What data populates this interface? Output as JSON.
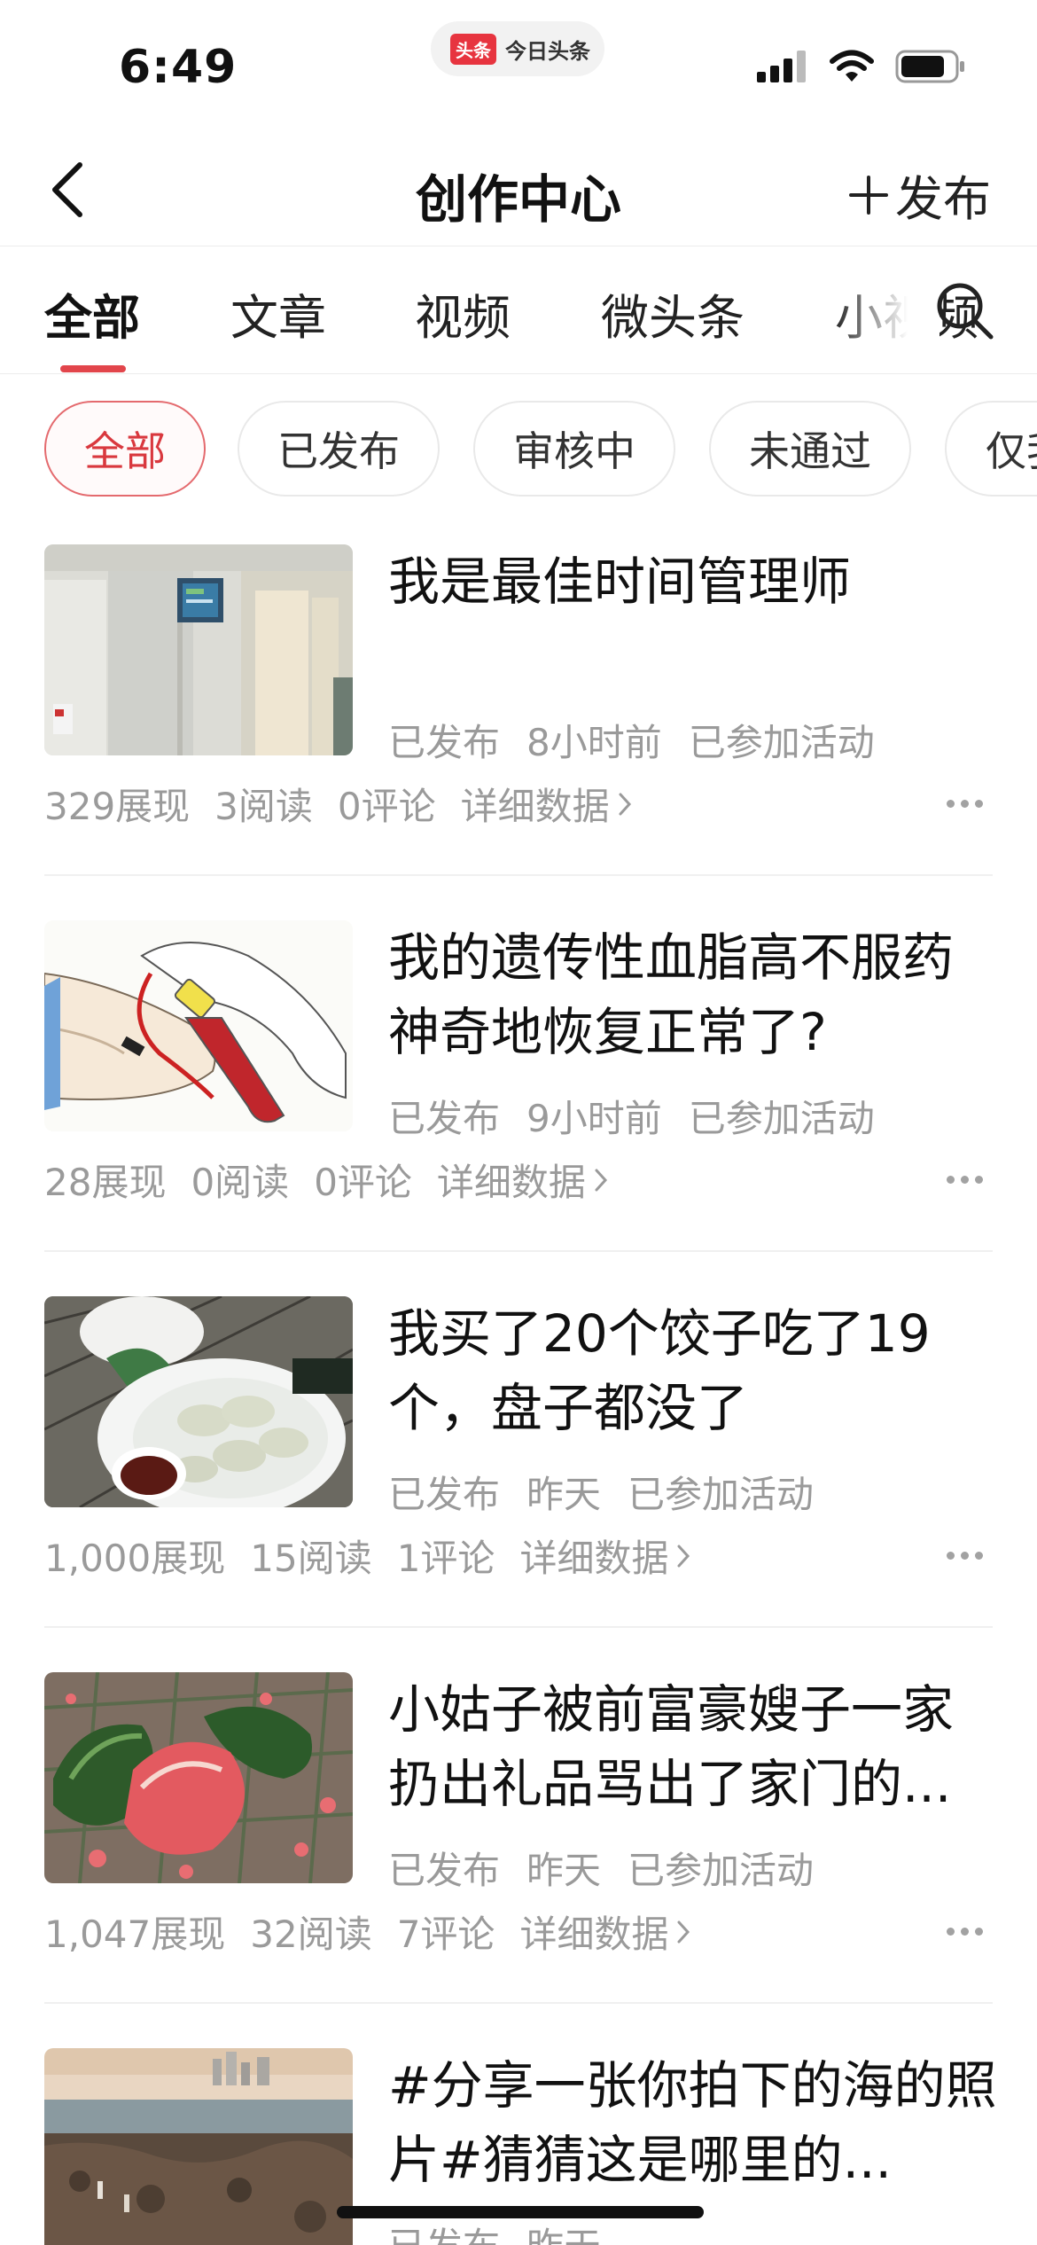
{
  "status_bar": {
    "time": "6:49",
    "pill_logo": "头条",
    "pill_text": "今日头条"
  },
  "nav": {
    "back_icon": "chevron-left-icon",
    "title": "创作中心",
    "publish_label": "发布"
  },
  "tabs": [
    {
      "label": "全部",
      "active": true
    },
    {
      "label": "文章",
      "active": false
    },
    {
      "label": "视频",
      "active": false
    },
    {
      "label": "微头条",
      "active": false
    },
    {
      "label": "小视频",
      "active": false
    }
  ],
  "chips": [
    {
      "label": "全部",
      "active": true
    },
    {
      "label": "已发布",
      "active": false
    },
    {
      "label": "审核中",
      "active": false
    },
    {
      "label": "未通过",
      "active": false
    },
    {
      "label": "仅我可见",
      "active": false
    }
  ],
  "items": [
    {
      "title": "我是最佳时间管理师",
      "status": "已发布",
      "time": "8小时前",
      "activity": "已参加活动",
      "views": "329展现",
      "reads": "3阅读",
      "comments": "0评论",
      "detail_label": "详细数据"
    },
    {
      "title": "我的遗传性血脂高不服药神奇地恢复正常了?",
      "status": "已发布",
      "time": "9小时前",
      "activity": "已参加活动",
      "views": "28展现",
      "reads": "0阅读",
      "comments": "0评论",
      "detail_label": "详细数据"
    },
    {
      "title": "我买了20个饺子吃了19个，盘子都没了",
      "status": "已发布",
      "time": "昨天",
      "activity": "已参加活动",
      "views": "1,000展现",
      "reads": "15阅读",
      "comments": "1评论",
      "detail_label": "详细数据"
    },
    {
      "title": "小姑子被前富豪嫂子一家扔出礼品骂出了家门的...",
      "status": "已发布",
      "time": "昨天",
      "activity": "已参加活动",
      "views": "1,047展现",
      "reads": "32阅读",
      "comments": "7评论",
      "detail_label": "详细数据"
    },
    {
      "title": "#分享一张你拍下的海的照片#猜猜这是哪里的...",
      "status": "已发布",
      "time": "昨天",
      "activity": "",
      "views": "",
      "reads": "",
      "comments": "",
      "detail_label": ""
    }
  ],
  "colors": {
    "accent": "#e2454b",
    "text_primary": "#111111",
    "text_secondary": "#9a9a9a"
  }
}
